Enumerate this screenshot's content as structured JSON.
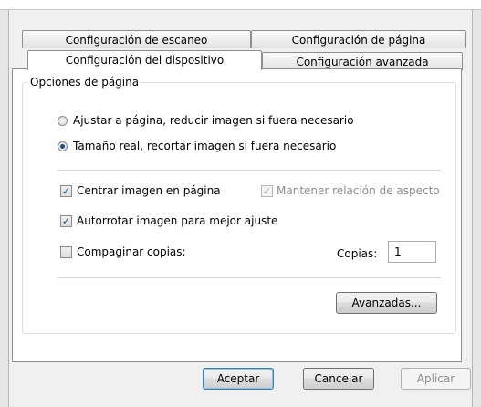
{
  "tabs": {
    "back_row": [
      {
        "label": "Configuración de escaneo"
      },
      {
        "label": "Configuración de página"
      }
    ],
    "front_row": [
      {
        "label": "Configuración del dispositivo",
        "active": true
      },
      {
        "label": "Configuración avanzada"
      }
    ]
  },
  "page_options": {
    "group_title": "Opciones de página",
    "radio_fit": {
      "label": "Ajustar a página, reducir imagen si fuera necesario",
      "selected": false
    },
    "radio_actual": {
      "label": "Tamaño real, recortar imagen si fuera necesario",
      "selected": true
    },
    "center_image": {
      "label": "Centrar imagen en página",
      "checked": true
    },
    "keep_aspect": {
      "label": "Mantener relación de aspecto",
      "checked": true,
      "enabled": false
    },
    "auto_rotate": {
      "label": "Autorrotar imagen para mejor ajuste",
      "checked": true
    },
    "collate": {
      "label": "Compaginar copias:",
      "checked": false
    },
    "copies": {
      "label": "Copias:",
      "value": "1"
    },
    "advanced_button": "Avanzadas..."
  },
  "footer": {
    "ok": "Aceptar",
    "cancel": "Cancelar",
    "apply": "Aplicar"
  }
}
